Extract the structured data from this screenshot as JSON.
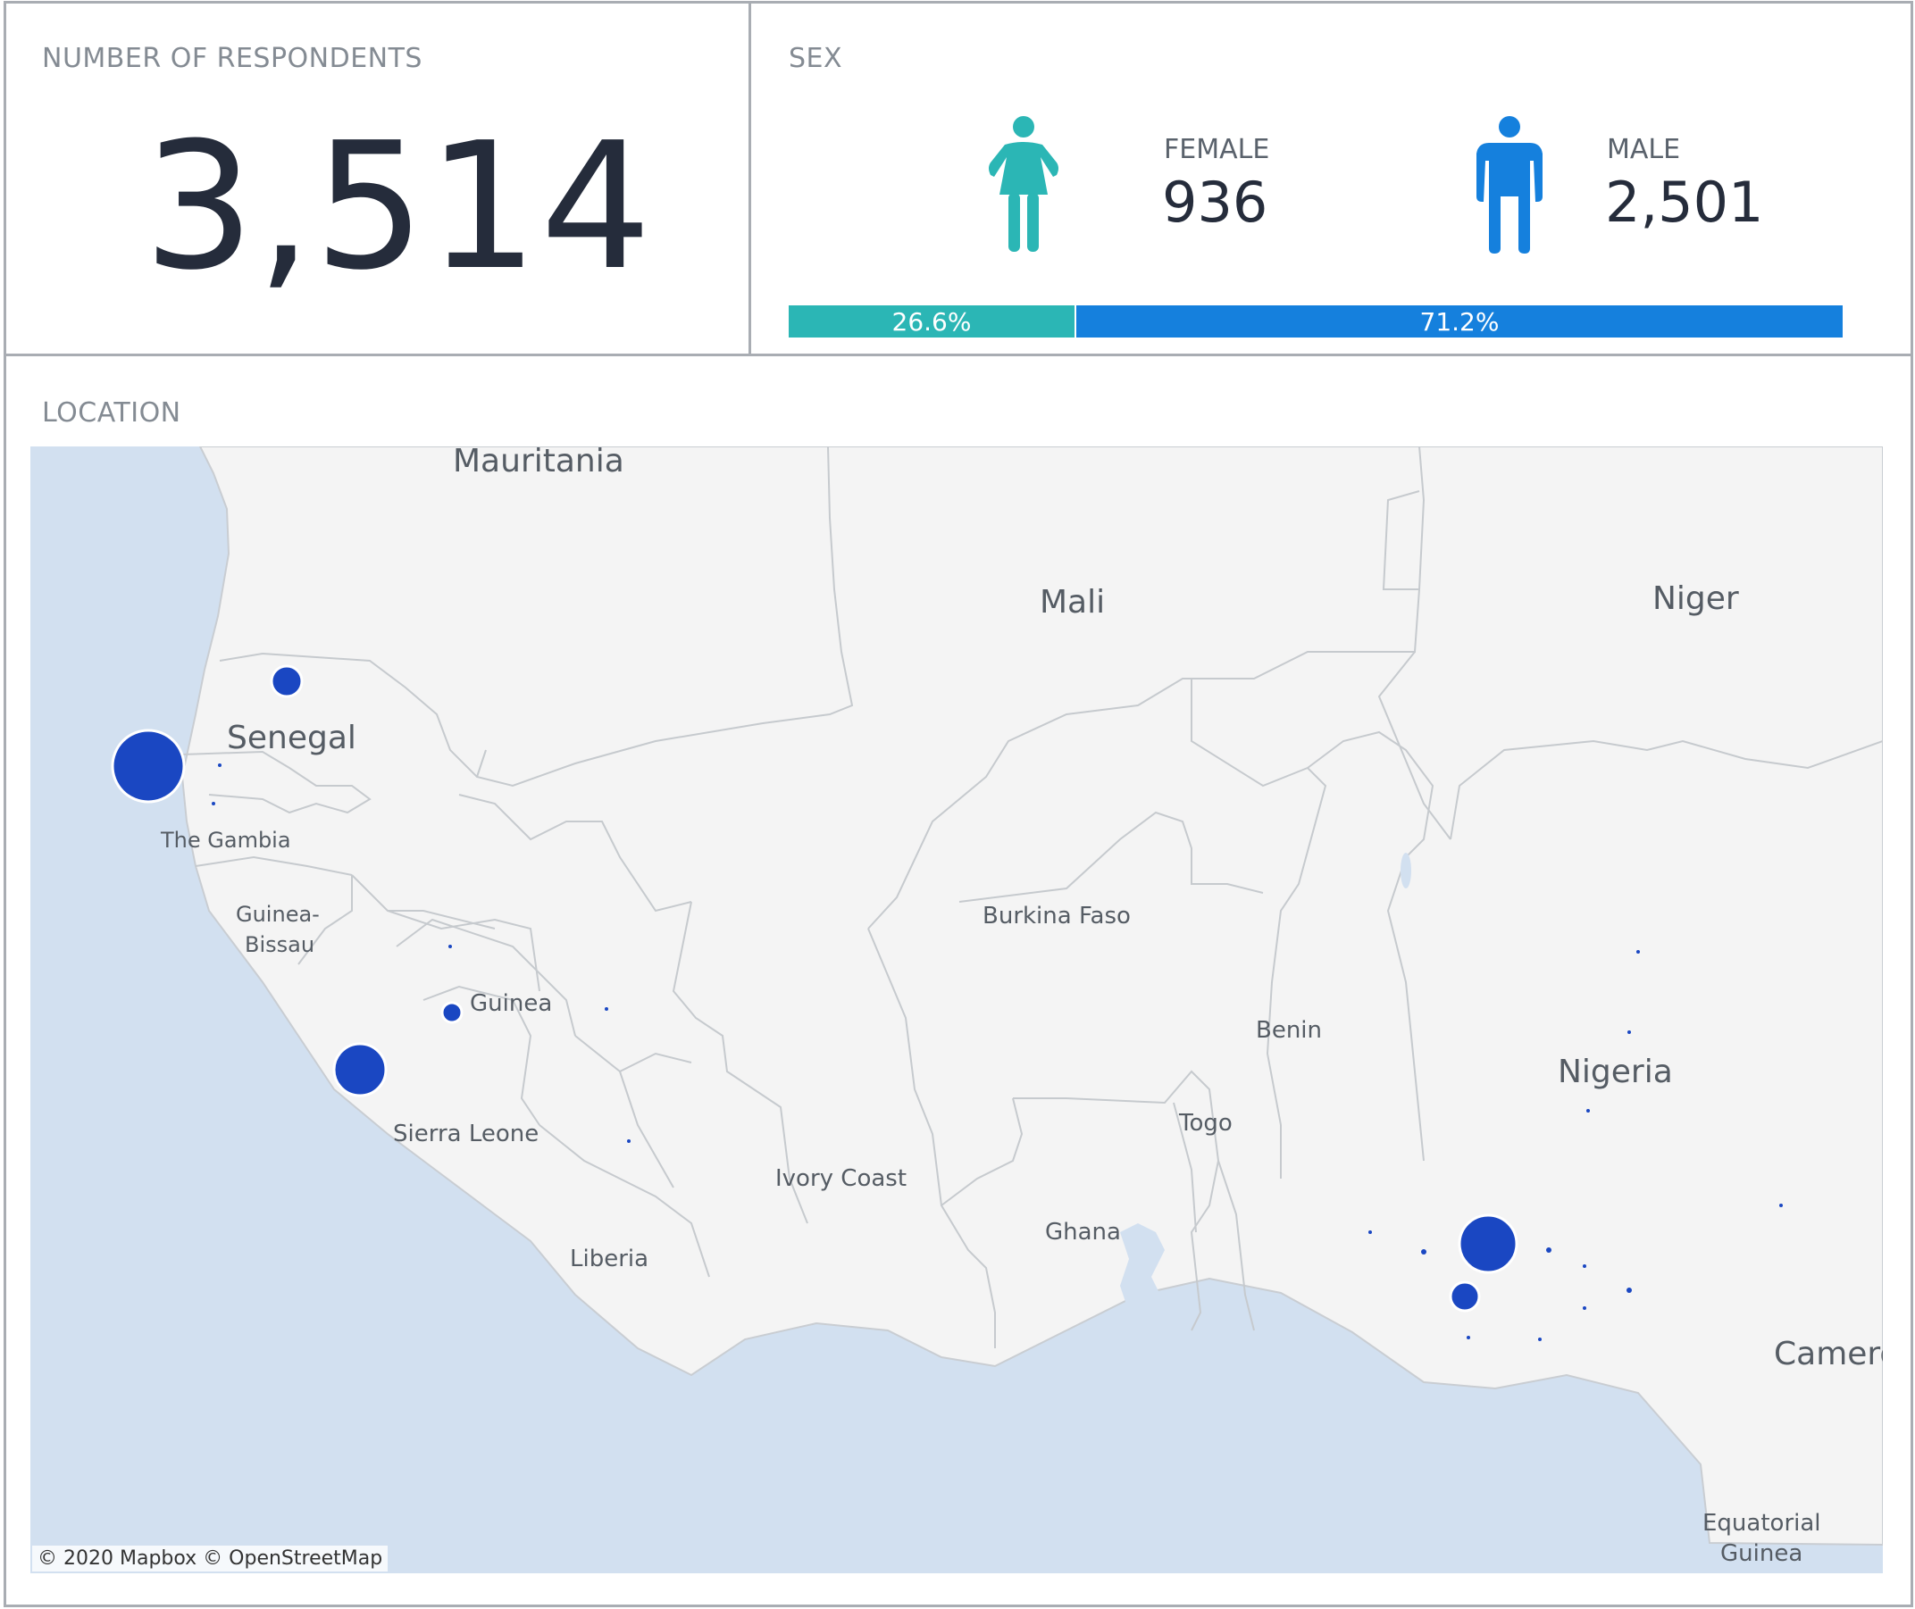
{
  "respondents": {
    "title": "NUMBER OF RESPONDENTS",
    "value": "3,514"
  },
  "sex": {
    "title": "SEX",
    "female": {
      "label": "FEMALE",
      "value": "936",
      "percent": "26.6%",
      "share": 26.6,
      "color": "#2bb6b5",
      "icon": "female-person-icon"
    },
    "male": {
      "label": "MALE",
      "value": "2,501",
      "percent": "71.2%",
      "share": 71.2,
      "color": "#1580dd",
      "icon": "male-person-icon"
    }
  },
  "location": {
    "title": "LOCATION",
    "attribution": "© 2020 Mapbox © OpenStreetMap",
    "bubble_color": "#1a47c2",
    "labels": {
      "mauritania": "Mauritania",
      "mali": "Mali",
      "niger": "Niger",
      "senegal": "Senegal",
      "gambia": "The Gambia",
      "guinea_bissau_1": "Guinea-",
      "guinea_bissau_2": "Bissau",
      "guinea": "Guinea",
      "sierra_leone": "Sierra Leone",
      "liberia": "Liberia",
      "ivory_coast": "Ivory Coast",
      "burkina_faso": "Burkina Faso",
      "ghana": "Ghana",
      "togo": "Togo",
      "benin": "Benin",
      "nigeria": "Nigeria",
      "cameroon": "Camero",
      "eq_guinea_1": "Equatorial",
      "eq_guinea_2": "Guinea"
    }
  }
}
